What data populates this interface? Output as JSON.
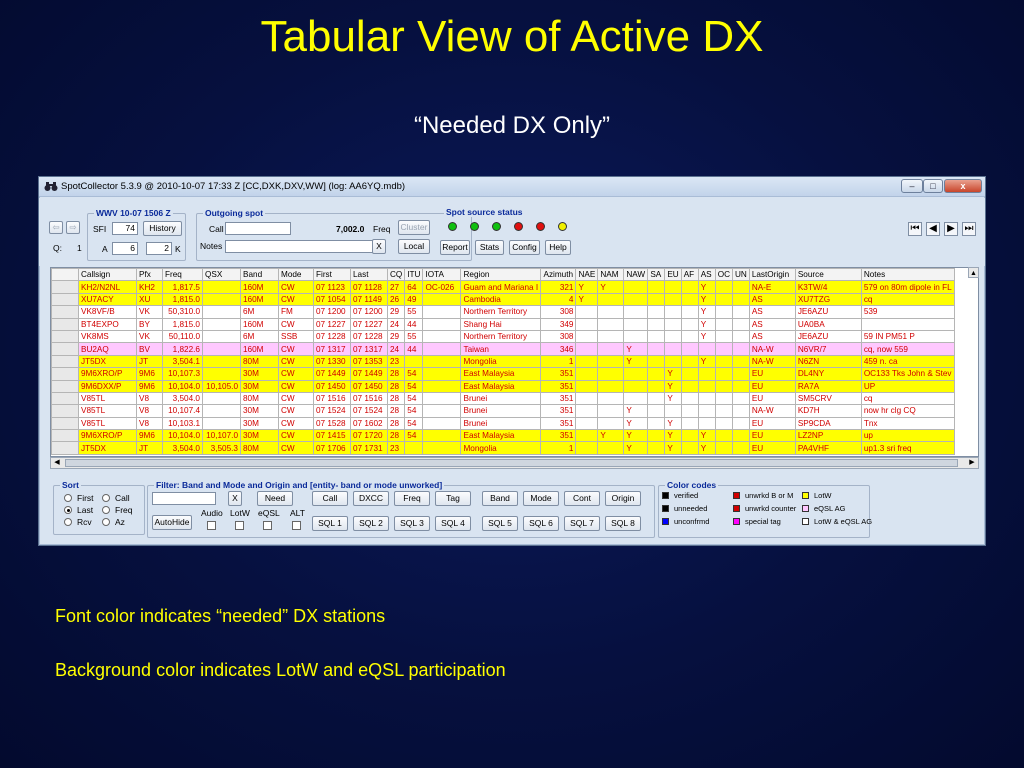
{
  "slide": {
    "title": "Tabular View of Active DX",
    "subtitle": "“Needed DX Only”",
    "caption1": "Font color indicates “needed” DX stations",
    "caption2": "Background color indicates LotW and eQSL participation"
  },
  "window": {
    "title": "SpotCollector 5.3.9 @ 2010-10-07  17:33 Z [CC,DXK,DXV,WW] (log: AA6YQ.mdb)",
    "min": "–",
    "max": "□",
    "close": "x"
  },
  "wwv": {
    "title": "WWV 10-07 1506 Z",
    "sfi_label": "SFI",
    "sfi": "74",
    "history": "History",
    "a_label": "A",
    "a": "6",
    "k": "2",
    "k_label": "K",
    "q_label": "Q:",
    "q": "1"
  },
  "outgoing": {
    "title": "Outgoing spot",
    "call_label": "Call",
    "freq_value": "7,002.0",
    "freq_label": "Freq",
    "cluster": "Cluster",
    "notes_label": "Notes",
    "x": "X",
    "local": "Local"
  },
  "spot_source": {
    "title": "Spot source status",
    "dots": [
      "#10c010",
      "#10c010",
      "#10c010",
      "#e01010",
      "#e01010",
      "#f0f000"
    ],
    "buttons": [
      "Report",
      "Stats",
      "Config",
      "Help"
    ]
  },
  "nav": [
    "⏮",
    "◀",
    "▶",
    "⏭"
  ],
  "grid": {
    "columns": [
      "Callsign",
      "Pfx",
      "Freq",
      "QSX",
      "Band",
      "Mode",
      "First",
      "Last",
      "CQ",
      "ITU",
      "IOTA",
      "Region",
      "Azimuth",
      "NAE",
      "NAM",
      "NAW",
      "SA",
      "EU",
      "AF",
      "AS",
      "OC",
      "UN",
      "LastOrigin",
      "Source",
      "Notes"
    ],
    "rows": [
      {
        "bg": "#ffff00",
        "fg": "#d00000",
        "cells": [
          "KH2/N2NL",
          "KH2",
          "1,817.5",
          "",
          "160M",
          "CW",
          "07 1123",
          "07 1128",
          "27",
          "64",
          "OC-026",
          "Guam and Mariana I",
          "321",
          "Y",
          "Y",
          "",
          "",
          "",
          "",
          "Y",
          "",
          "",
          "NA-E",
          "K3TW/4",
          "579 on 80m dipole in FL"
        ]
      },
      {
        "bg": "#ffff00",
        "fg": "#d00000",
        "cells": [
          "XU7ACY",
          "XU",
          "1,815.0",
          "",
          "160M",
          "CW",
          "07 1054",
          "07 1149",
          "26",
          "49",
          "",
          "Cambodia",
          "4",
          "Y",
          "",
          "",
          "",
          "",
          "",
          "Y",
          "",
          "",
          "AS",
          "XU7TZG",
          "cq"
        ]
      },
      {
        "bg": "#ffffff",
        "fg": "#d00000",
        "cells": [
          "VK8VF/B",
          "VK",
          "50,310.0",
          "",
          "6M",
          "FM",
          "07 1200",
          "07 1200",
          "29",
          "55",
          "",
          "Northern Territory",
          "308",
          "",
          "",
          "",
          "",
          "",
          "",
          "Y",
          "",
          "",
          "AS",
          "JE6AZU",
          "539"
        ]
      },
      {
        "bg": "#ffffff",
        "fg": "#d00000",
        "cells": [
          "BT4EXPO",
          "BY",
          "1,815.0",
          "",
          "160M",
          "CW",
          "07 1227",
          "07 1227",
          "24",
          "44",
          "",
          "Shang Hai",
          "349",
          "",
          "",
          "",
          "",
          "",
          "",
          "Y",
          "",
          "",
          "AS",
          "UA0BA",
          ""
        ]
      },
      {
        "bg": "#ffffff",
        "fg": "#d00000",
        "cells": [
          "VK8MS",
          "VK",
          "50,110.0",
          "",
          "6M",
          "SSB",
          "07 1228",
          "07 1228",
          "29",
          "55",
          "",
          "Northern Territory",
          "308",
          "",
          "",
          "",
          "",
          "",
          "",
          "Y",
          "",
          "",
          "AS",
          "JE6AZU",
          "59 IN PM51          P"
        ]
      },
      {
        "bg": "#ffc8ff",
        "fg": "#d00000",
        "cells": [
          "BU2AQ",
          "BV",
          "1,822.6",
          "",
          "160M",
          "CW",
          "07 1317",
          "07 1317",
          "24",
          "44",
          "",
          "Taiwan",
          "346",
          "",
          "",
          "Y",
          "",
          "",
          "",
          "",
          "",
          "",
          "NA-W",
          "N6VR/7",
          "cq, now 559"
        ]
      },
      {
        "bg": "#ffff00",
        "fg": "#d00000",
        "cells": [
          "JT5DX",
          "JT",
          "3,504.1",
          "",
          "80M",
          "CW",
          "07 1330",
          "07 1353",
          "23",
          "",
          "",
          "Mongolia",
          "1",
          "",
          "",
          "Y",
          "",
          "",
          "",
          "Y",
          "",
          "",
          "NA-W",
          "N6ZN",
          "459 n. ca"
        ]
      },
      {
        "bg": "#ffff00",
        "fg": "#d00000",
        "cells": [
          "9M6XRO/P",
          "9M6",
          "10,107.3",
          "",
          "30M",
          "CW",
          "07 1449",
          "07 1449",
          "28",
          "54",
          "",
          "East Malaysia",
          "351",
          "",
          "",
          "",
          "",
          "Y",
          "",
          "",
          "",
          "",
          "EU",
          "DL4NY",
          "OC133 Tks John & Stev"
        ]
      },
      {
        "bg": "#ffff00",
        "fg": "#d00000",
        "cells": [
          "9M6DXX/P",
          "9M6",
          "10,104.0",
          "10,105.0",
          "30M",
          "CW",
          "07 1450",
          "07 1450",
          "28",
          "54",
          "",
          "East Malaysia",
          "351",
          "",
          "",
          "",
          "",
          "Y",
          "",
          "",
          "",
          "",
          "EU",
          "RA7A",
          "UP"
        ]
      },
      {
        "bg": "#ffffff",
        "fg": "#d00000",
        "cells": [
          "V85TL",
          "V8",
          "3,504.0",
          "",
          "80M",
          "CW",
          "07 1516",
          "07 1516",
          "28",
          "54",
          "",
          "Brunei",
          "351",
          "",
          "",
          "",
          "",
          "Y",
          "",
          "",
          "",
          "",
          "EU",
          "SM5CRV",
          "cq"
        ]
      },
      {
        "bg": "#ffffff",
        "fg": "#d00000",
        "cells": [
          "V85TL",
          "V8",
          "10,107.4",
          "",
          "30M",
          "CW",
          "07 1524",
          "07 1524",
          "28",
          "54",
          "",
          "Brunei",
          "351",
          "",
          "",
          "Y",
          "",
          "",
          "",
          "",
          "",
          "",
          "NA-W",
          "KD7H",
          "now hr clg CQ"
        ]
      },
      {
        "bg": "#ffffff",
        "fg": "#d00000",
        "cells": [
          "V85TL",
          "V8",
          "10,103.1",
          "",
          "30M",
          "CW",
          "07 1528",
          "07 1602",
          "28",
          "54",
          "",
          "Brunei",
          "351",
          "",
          "",
          "Y",
          "",
          "Y",
          "",
          "",
          "",
          "",
          "EU",
          "SP9CDA",
          "Tnx"
        ]
      },
      {
        "bg": "#ffff00",
        "fg": "#d00000",
        "cells": [
          "9M6XRO/P",
          "9M6",
          "10,104.0",
          "10,107.0",
          "30M",
          "CW",
          "07 1415",
          "07 1720",
          "28",
          "54",
          "",
          "East Malaysia",
          "351",
          "",
          "Y",
          "Y",
          "",
          "Y",
          "",
          "Y",
          "",
          "",
          "EU",
          "LZ2NP",
          "up"
        ]
      },
      {
        "bg": "#ffff00",
        "fg": "#d00000",
        "cells": [
          "JT5DX",
          "JT",
          "3,504.0",
          "3,505.3",
          "80M",
          "CW",
          "07 1706",
          "07 1731",
          "23",
          "",
          "",
          "Mongolia",
          "1",
          "",
          "",
          "Y",
          "",
          "Y",
          "",
          "Y",
          "",
          "",
          "EU",
          "PA4VHF",
          "up1.3 sri freq"
        ]
      }
    ]
  },
  "sort": {
    "title": "Sort",
    "options": [
      "First",
      "Call",
      "Last",
      "Freq",
      "Rcv",
      "Az"
    ],
    "selected": "Last"
  },
  "filter": {
    "title": "Filter: Band and Mode and Origin and [entity- band or mode unworked]",
    "x": "X",
    "need": "Need",
    "autohide": "AutoHide",
    "checks": [
      "Audio",
      "LotW",
      "eQSL",
      "ALT"
    ],
    "row1": [
      "Call",
      "DXCC",
      "Freq",
      "Tag",
      "Band",
      "Mode",
      "Cont",
      "Origin"
    ],
    "row2": [
      "SQL 1",
      "SQL 2",
      "SQL 3",
      "SQL 4",
      "SQL 5",
      "SQL 6",
      "SQL 7",
      "SQL 8"
    ]
  },
  "color_codes": {
    "title": "Color codes",
    "items": [
      {
        "color": "#000000",
        "label": "verified"
      },
      {
        "color": "#d00000",
        "label": "unwrkd B or M"
      },
      {
        "color": "#ffff00",
        "label": "LotW"
      },
      {
        "color": "#000000",
        "label": "unneeded"
      },
      {
        "color": "#d00000",
        "label": "unwrkd counter"
      },
      {
        "color": "#ffc8ff",
        "label": "eQSL AG"
      },
      {
        "color": "#0000ff",
        "label": "unconfrmd"
      },
      {
        "color": "#ff00ff",
        "label": "special tag"
      },
      {
        "color": "#ffffff",
        "label": "LotW & eQSL AG"
      }
    ]
  }
}
